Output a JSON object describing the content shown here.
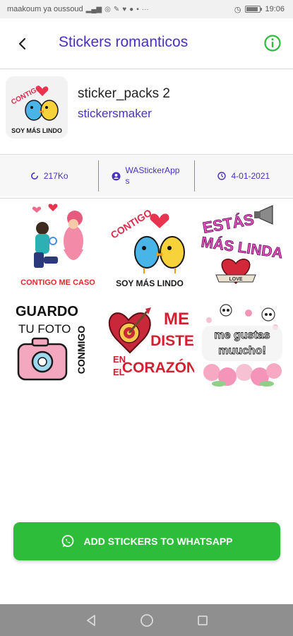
{
  "status_bar": {
    "carrier": "maakoum ya oussoud",
    "time": "19:06",
    "battery_level": 0.85
  },
  "app_bar": {
    "title": "Stickers romanticos",
    "back_icon": "arrow-back-icon",
    "info_icon": "info-circle-icon"
  },
  "pack": {
    "name": "sticker_packs 2",
    "author": "stickersmaker"
  },
  "info": {
    "size": "217Ko",
    "publisher": "WAStickerApps",
    "date": "4-01-2021"
  },
  "stickers": [
    {
      "name": "contigo-me-caso",
      "text": "CONTIGO ME CASO"
    },
    {
      "name": "contigo-soy-mas-lindo",
      "text": "CONTIGO SOY MÁS LINDO"
    },
    {
      "name": "estas-mas-linda",
      "text": "ESTÁS MÁS LINDA"
    },
    {
      "name": "guardo-tu-foto-conmigo",
      "text": "GUARDO TU FOTO CONMIGO"
    },
    {
      "name": "me-diste-en-el-corazon",
      "text": "ME DISTE EN EL CORAZÓN"
    },
    {
      "name": "me-gustas-muucho",
      "text": "me gustas muucho!"
    }
  ],
  "tray_text": {
    "top": "CONTIGO",
    "bottom": "SOY MÁS LINDO"
  },
  "sticker_labels": {
    "s1": "CONTIGO ME CASO",
    "s2_top": "CONTIGO",
    "s2_bottom": "SOY MÁS LINDO",
    "s3_line1": "ESTÁS",
    "s3_line2": "MÁS LINDA",
    "s3_ribbon": "LOVE",
    "s4_line1": "GUARDO",
    "s4_line2": "TU FOTO",
    "s4_side": "CONMIGO",
    "s5_me": "ME",
    "s5_diste": "DISTE",
    "s5_en": "EN",
    "s5_el": "EL",
    "s5_corazon": "CORAZÓN",
    "s6_line1": "me gustas",
    "s6_line2": "muucho!"
  },
  "add_button": {
    "label": "ADD STICKERS TO WHATSAPP",
    "icon": "whatsapp-icon"
  },
  "colors": {
    "accent": "#4a2fc2",
    "button": "#2ebc3b",
    "nav_bar": "#8f8f8f"
  }
}
